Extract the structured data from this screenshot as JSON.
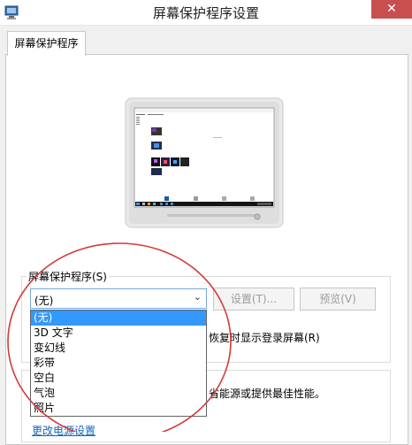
{
  "window": {
    "title": "屏幕保护程序设置",
    "close_glyph": "✕"
  },
  "tabs": [
    {
      "label": "屏幕保护程序"
    }
  ],
  "screensaver": {
    "group_label": "屏幕保护程序(S)",
    "selected": "(无)",
    "settings_button": "设置(T)...",
    "preview_button": "预览(V)",
    "options": [
      "(无)",
      "3D 文字",
      "变幻线",
      "彩带",
      "空白",
      "气泡",
      "照片"
    ],
    "resume_text": "恢复时显示登录屏幕(R)"
  },
  "power": {
    "description_fragment": "省能源或提供最佳性能。",
    "link": "更改电源设置"
  },
  "colors": {
    "accent": "#3399ff",
    "close": "#c74f4f",
    "annotation": "#d23c3c",
    "link": "#1565b7"
  }
}
